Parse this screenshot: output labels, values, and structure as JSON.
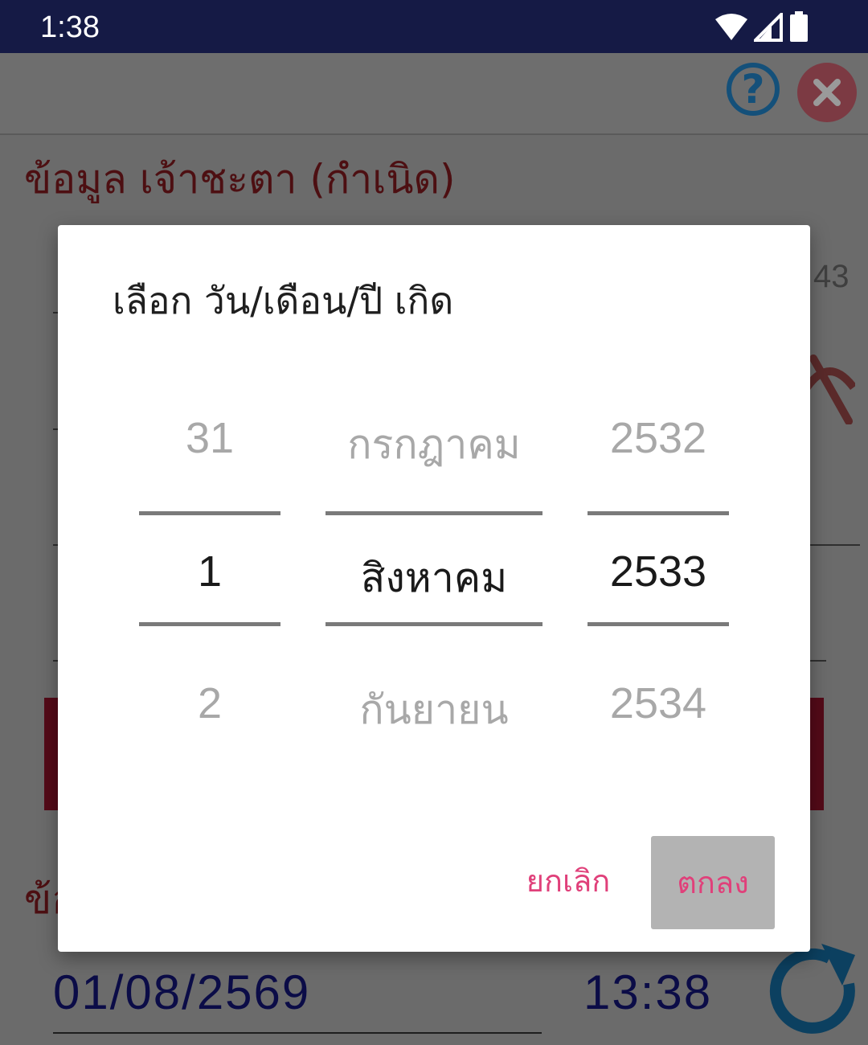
{
  "status_bar": {
    "time": "1:38",
    "icons": [
      "wifi-icon",
      "signal-icon",
      "battery-icon"
    ]
  },
  "background": {
    "section_title": "ข้อมูล เจ้าชะตา (กำเนิด)",
    "section_title_2": "ข้อ",
    "partial_number": "43",
    "date_value": "01/08/2569",
    "time_value": "13:38"
  },
  "dialog": {
    "title": "เลือก วัน/เดือน/ปี เกิด",
    "day": {
      "prev": "31",
      "selected": "1",
      "next": "2"
    },
    "month": {
      "prev": "กรกฎาคม",
      "selected": "สิงหาคม",
      "next": "กันยายน"
    },
    "year": {
      "prev": "2532",
      "selected": "2533",
      "next": "2534"
    },
    "cancel_label": "ยกเลิก",
    "ok_label": "ตกลง"
  },
  "colors": {
    "status_bar": "#151a45",
    "accent": "#e0407a",
    "title_text": "#4d0f12",
    "value_text": "#0b0c47"
  }
}
